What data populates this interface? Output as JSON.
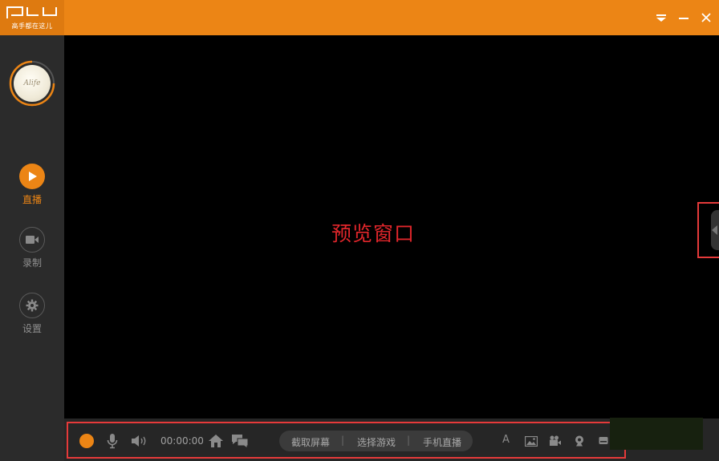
{
  "app": {
    "logo_text": "PLU",
    "slogan": "高手都在这儿",
    "brand_color": "#ec8515"
  },
  "window_controls": {
    "menu_icon": "menu-dropdown-icon",
    "minimize_icon": "minimize-icon",
    "close_icon": "close-icon"
  },
  "user": {
    "avatar_text": "Alife"
  },
  "sidebar": {
    "items": [
      {
        "label": "直播",
        "icon": "play-icon",
        "active": true
      },
      {
        "label": "录制",
        "icon": "video-camera-icon",
        "active": false
      },
      {
        "label": "设置",
        "icon": "gear-icon",
        "active": false
      }
    ]
  },
  "preview": {
    "label": "预览窗口",
    "label_color": "#e0262b"
  },
  "controls": {
    "record_icon": "record-dot-icon",
    "mic_icon": "microphone-icon",
    "speaker_icon": "speaker-icon",
    "timer": "00:00:00",
    "home_icon": "home-icon",
    "chat_icon": "chat-icon",
    "quick_actions": [
      "截取屏幕",
      "选择游戏",
      "手机直播"
    ],
    "separator": "|",
    "text_tool": "A",
    "image_icon": "image-icon",
    "camera_icon": "film-camera-icon",
    "webcam_icon": "webcam-icon",
    "screen_icon": "screen-icon"
  }
}
